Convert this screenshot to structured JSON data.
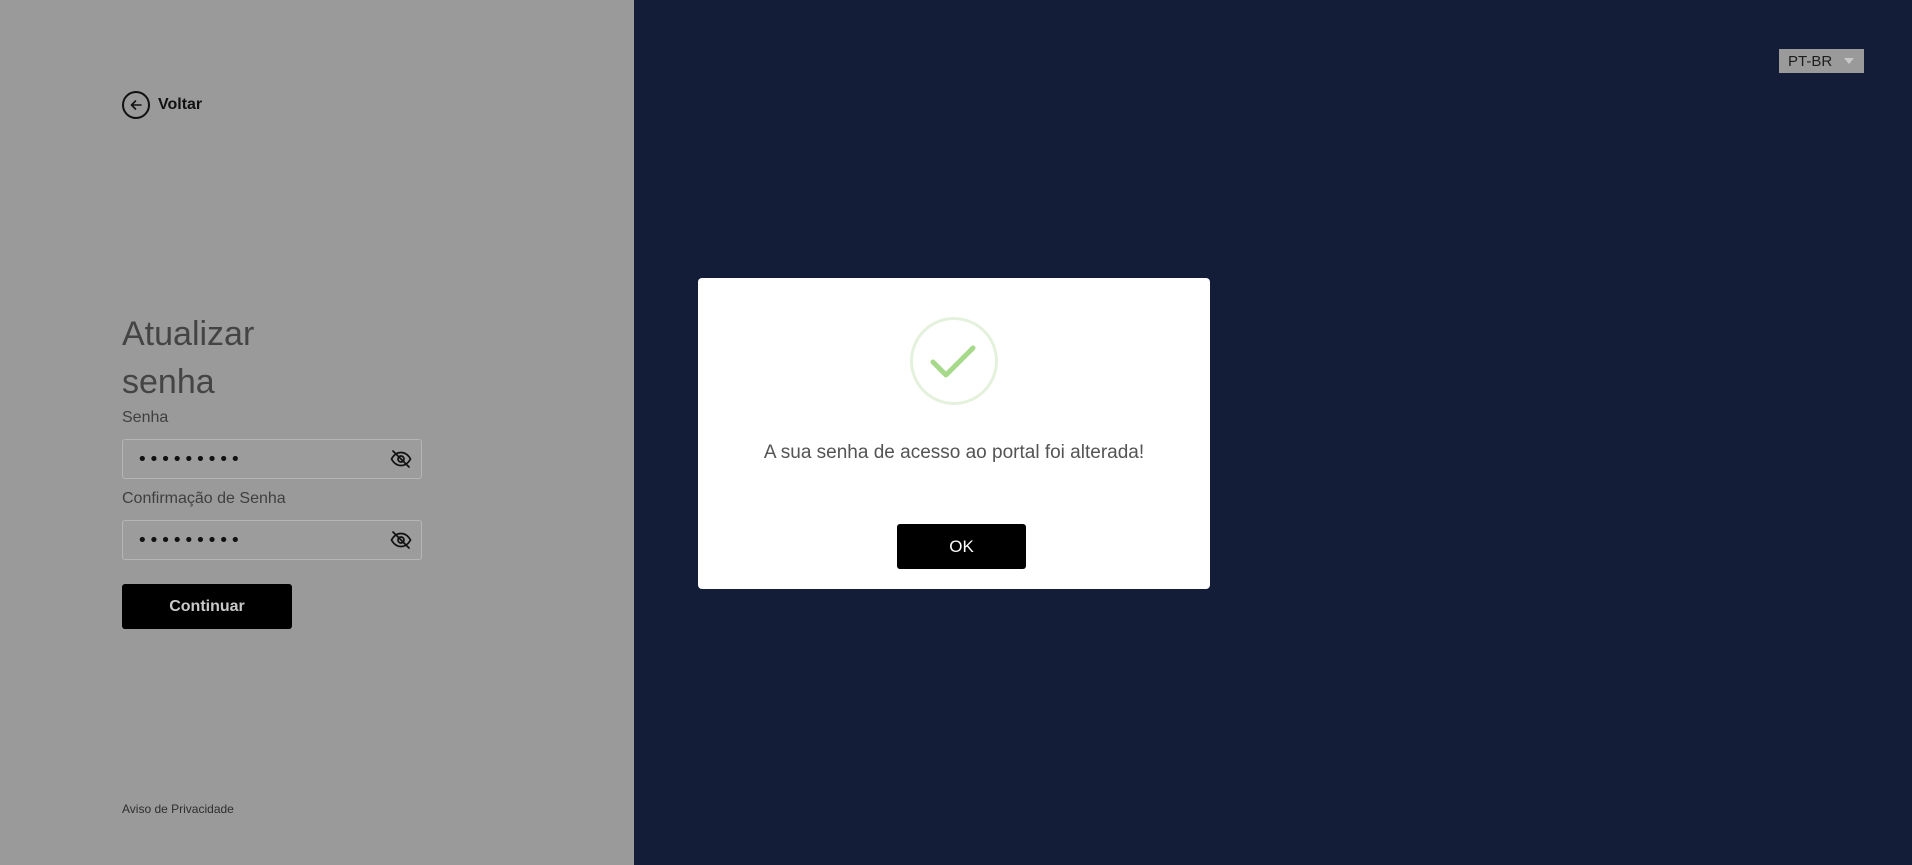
{
  "back": {
    "label": "Voltar"
  },
  "form": {
    "title": "Atualizar senha",
    "password_label": "Senha",
    "password_value": "•••••••••",
    "confirm_label": "Confirmação de Senha",
    "confirm_value": "•••••••••",
    "submit_label": "Continuar"
  },
  "footer": {
    "privacy_label": "Aviso de Privacidade"
  },
  "language": {
    "selected": "PT-BR"
  },
  "modal": {
    "icon": "check-icon",
    "message": "A sua senha de acesso ao portal foi alterada!",
    "ok_label": "OK"
  },
  "colors": {
    "left_panel_overlay": "#9a9a9a",
    "right_panel": "#141d38",
    "modal_bg": "#ffffff",
    "success_green": "#a6d98a",
    "button_bg": "#000000"
  }
}
